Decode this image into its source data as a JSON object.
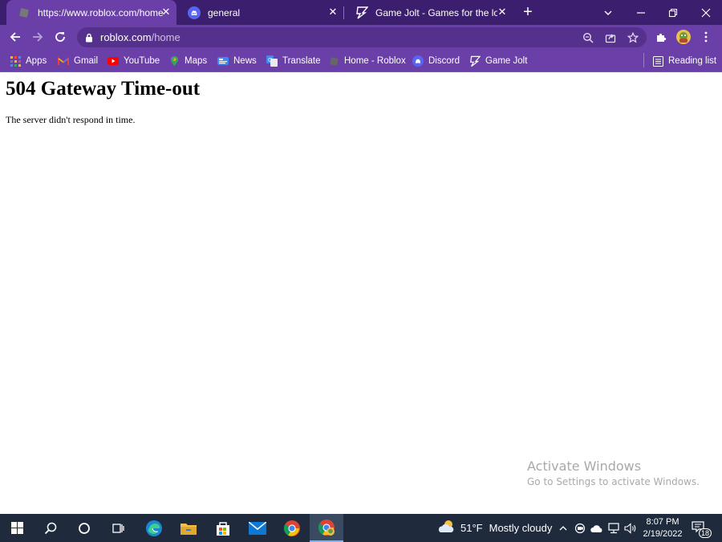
{
  "browser": {
    "tabs": [
      {
        "title": "https://www.roblox.com/home",
        "active": true,
        "favicon": "roblox-favicon",
        "close": "✕"
      },
      {
        "title": "general",
        "active": false,
        "favicon": "discord-icon",
        "close": "✕"
      },
      {
        "title": "Game Jolt - Games for the love of",
        "active": false,
        "favicon": "gamejolt-icon",
        "close": "✕"
      }
    ],
    "newtab_label": "+",
    "address": {
      "host": "roblox.com",
      "path": "/home"
    },
    "bookmarks": [
      {
        "label": "Apps",
        "icon": "apps-grid-icon"
      },
      {
        "label": "Gmail",
        "icon": "gmail-icon"
      },
      {
        "label": "YouTube",
        "icon": "youtube-icon"
      },
      {
        "label": "Maps",
        "icon": "maps-icon"
      },
      {
        "label": "News",
        "icon": "news-icon"
      },
      {
        "label": "Translate",
        "icon": "translate-icon"
      },
      {
        "label": "Home - Roblox",
        "icon": "roblox-favicon"
      },
      {
        "label": "Discord",
        "icon": "discord-icon"
      },
      {
        "label": "Game Jolt",
        "icon": "gamejolt-icon"
      }
    ],
    "reading_list": "Reading list",
    "colors": {
      "frame": "#3b1f6e",
      "toolbar": "#6a3fa8",
      "omnibox": "#55308c"
    }
  },
  "page": {
    "heading": "504 Gateway Time-out",
    "message": "The server didn't respond in time."
  },
  "watermark": {
    "line1": "Activate Windows",
    "line2": "Go to Settings to activate Windows."
  },
  "taskbar": {
    "weather": {
      "temp": "51°F",
      "condition": "Mostly cloudy"
    },
    "clock": {
      "time": "8:07 PM",
      "date": "2/19/2022"
    },
    "notification_count": "18"
  }
}
